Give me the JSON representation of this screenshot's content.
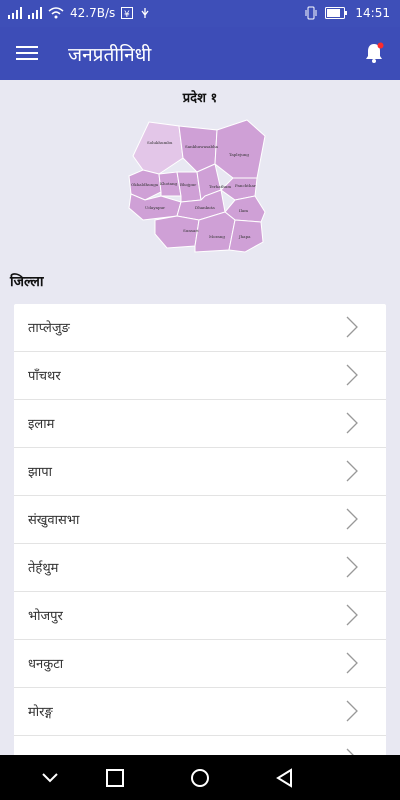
{
  "status": {
    "network_speed": "42.7B/s",
    "time": "14:51"
  },
  "app": {
    "title": "जनप्रतीनिधी",
    "province_title": "प्रदेश १",
    "section_label": "जिल्ला"
  },
  "map_labels": [
    "Solukhumbu",
    "Sankhuwasabha",
    "Taplejung",
    "Okhaldhunga",
    "Khotang",
    "Bhojpur",
    "Terhathum",
    "Panchthar",
    "Udayapur",
    "Dhankuta",
    "Ilam",
    "Sunsari",
    "Morang",
    "Jhapa"
  ],
  "districts": [
    {
      "label": "ताप्लेजुङ"
    },
    {
      "label": "पाँचथर"
    },
    {
      "label": "इलाम"
    },
    {
      "label": "झापा"
    },
    {
      "label": "संखुवासभा"
    },
    {
      "label": "तेर्हथुम"
    },
    {
      "label": "भोजपुर"
    },
    {
      "label": "धनकुटा"
    },
    {
      "label": "मोरङ्ग"
    }
  ],
  "colors": {
    "primary": "#3d4db7",
    "map_fill": "#cfa0d6",
    "map_fill_light": "#e3c6e8",
    "notification_dot": "#ff2b2b"
  },
  "icons": {
    "menu": "menu-icon",
    "bell": "bell-icon",
    "chevron": "chevron-right-icon"
  }
}
